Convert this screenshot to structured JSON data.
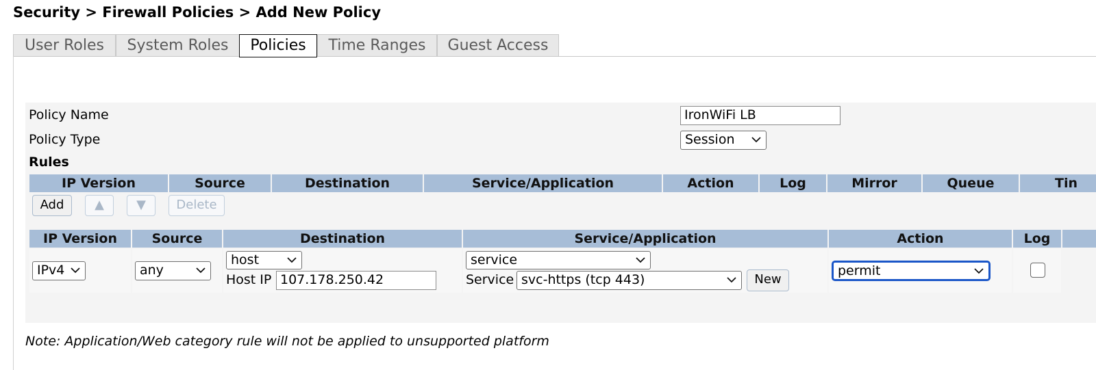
{
  "breadcrumb": "Security > Firewall Policies > Add New Policy",
  "tabs": [
    {
      "label": "User Roles",
      "active": false
    },
    {
      "label": "System Roles",
      "active": false
    },
    {
      "label": "Policies",
      "active": true
    },
    {
      "label": "Time Ranges",
      "active": false
    },
    {
      "label": "Guest Access",
      "active": false
    }
  ],
  "policy": {
    "name_label": "Policy Name",
    "name_value": "IronWiFi LB",
    "type_label": "Policy Type",
    "type_value": "Session"
  },
  "rules": {
    "title": "Rules",
    "columns": [
      "IP Version",
      "Source",
      "Destination",
      "Service/Application",
      "Action",
      "Log",
      "Mirror",
      "Queue",
      "Tin"
    ],
    "buttons": {
      "add": "Add",
      "up": "▲",
      "down": "▼",
      "delete": "Delete"
    }
  },
  "editor": {
    "columns": [
      "IP Version",
      "Source",
      "Destination",
      "Service/Application",
      "Action",
      "Log"
    ],
    "ip_version": "IPv4",
    "source": "any",
    "destination_type": "host",
    "host_ip_label": "Host IP",
    "host_ip_value": "107.178.250.42",
    "service_type": "service",
    "service_label": "Service",
    "service_value": "svc-https (tcp 443)",
    "new_button": "New",
    "action": "permit",
    "log_checked": false
  },
  "note": "Note: Application/Web category rule will not be applied to unsupported platform",
  "colors": {
    "header_bg": "#a7bdd7",
    "focus": "#1a56c8"
  }
}
